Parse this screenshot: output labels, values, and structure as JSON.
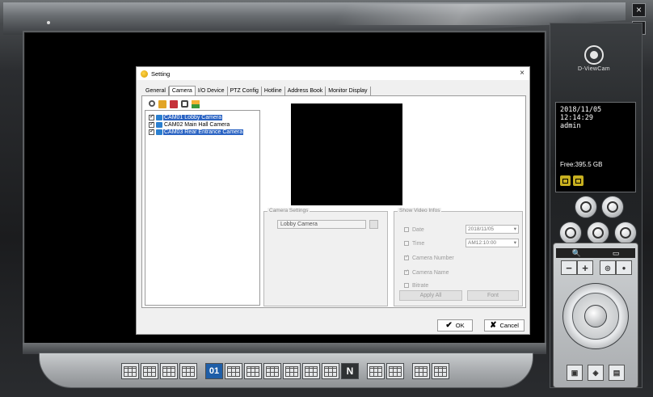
{
  "dialog": {
    "title": "Setting",
    "close": "×",
    "tabs": [
      {
        "label": "General"
      },
      {
        "label": "Camera"
      },
      {
        "label": "I/O Device"
      },
      {
        "label": "PTZ Config"
      },
      {
        "label": "Hotline"
      },
      {
        "label": "Address Book"
      },
      {
        "label": "Monitor Display"
      }
    ],
    "cameras": [
      {
        "label": "CAM01 Lobby Camera"
      },
      {
        "label": "CAM02 Main Hall Camera"
      },
      {
        "label": "CAM03 Rear Entrance Camera"
      }
    ],
    "camera_settings": {
      "legend": "Camera Settings",
      "name_value": "Lobby Camera"
    },
    "video_infos": {
      "legend": "Show Video Infos",
      "date_label": "Date",
      "date_value": "2018/11/05",
      "time_label": "Time",
      "time_value": "AM12:10:00",
      "camera_number_label": "Camera Number",
      "camera_name_label": "Camera Name",
      "bitrate_label": "Bitrate",
      "apply_all": "Apply All",
      "font": "Font"
    },
    "ok_label": "OK",
    "cancel_label": "Cancel",
    "ok_symbol": "✔",
    "cancel_symbol": "✘"
  },
  "status": {
    "date": "2018/11/05",
    "time": "12:14:29",
    "user": "admin",
    "free_space": "Free:395.5 GB"
  },
  "logo": {
    "text": "D-ViewCam"
  },
  "layout_bar": {
    "single_label": "01",
    "n_label": "N"
  },
  "window": {
    "close": "×",
    "minimize": "–"
  }
}
